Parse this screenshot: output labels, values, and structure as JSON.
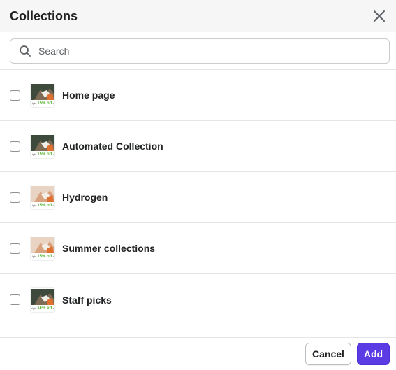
{
  "dialog": {
    "title": "Collections",
    "close_icon": "close-icon"
  },
  "search": {
    "icon": "search-icon",
    "placeholder": "Search",
    "value": ""
  },
  "collections": [
    {
      "label": "Home page",
      "checked": false,
      "thumb_variant": "dark"
    },
    {
      "label": "Automated Collection",
      "checked": false,
      "thumb_variant": "dark"
    },
    {
      "label": "Hydrogen",
      "checked": false,
      "thumb_variant": "light"
    },
    {
      "label": "Summer collections",
      "checked": false,
      "thumb_variant": "light"
    },
    {
      "label": "Staff picks",
      "checked": false,
      "thumb_variant": "dark"
    }
  ],
  "thumbnail_caption": {
    "prefix": "Upto",
    "highlight": "15% off",
    "suffix": "on"
  },
  "footer": {
    "cancel_label": "Cancel",
    "add_label": "Add"
  },
  "colors": {
    "primary": "#5b3ce4",
    "header_bg": "#f6f6f7",
    "border": "#e4e5e7"
  }
}
